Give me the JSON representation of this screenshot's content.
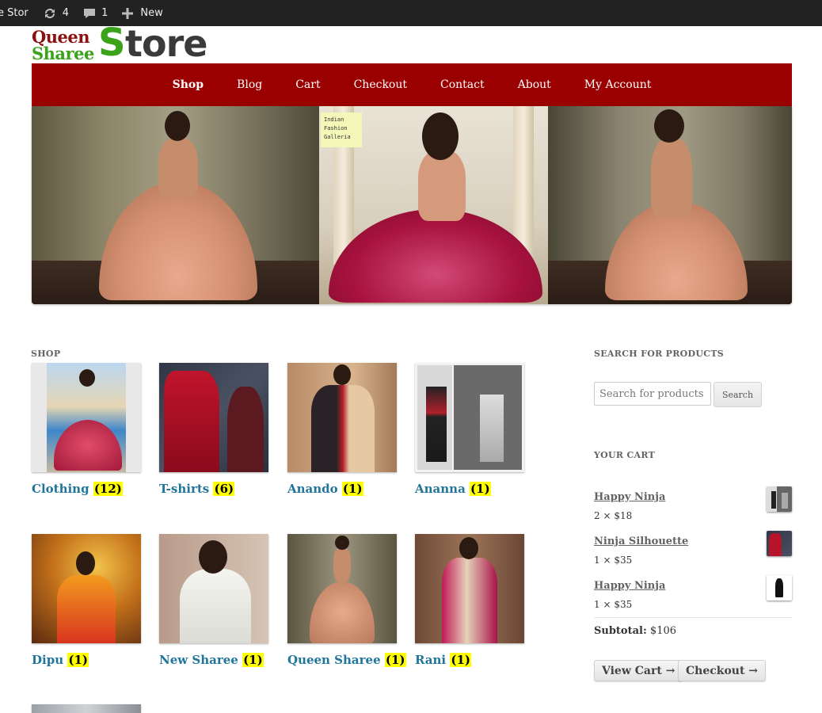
{
  "adminbar": {
    "site_name": "e Stor",
    "updates_count": "4",
    "comments_count": "1",
    "new_label": "New"
  },
  "logo": {
    "line1": "Queen",
    "line2": "Sharee",
    "store_s": "S",
    "store_rest": "tore"
  },
  "nav": {
    "items": [
      "Shop",
      "Blog",
      "Cart",
      "Checkout",
      "Contact",
      "About",
      "My Account"
    ]
  },
  "banner": {
    "badge_text": "Indian Fashion Galleria"
  },
  "shop": {
    "title": "SHOP",
    "categories": [
      {
        "name": "Clothing",
        "count": "(12)"
      },
      {
        "name": "T-shirts",
        "count": "(6)"
      },
      {
        "name": "Anando",
        "count": "(1)"
      },
      {
        "name": "Ananna",
        "count": "(1)"
      },
      {
        "name": "Dipu",
        "count": "(1)"
      },
      {
        "name": "New Sharee",
        "count": "(1)"
      },
      {
        "name": "Queen Sharee",
        "count": "(1)"
      },
      {
        "name": "Rani",
        "count": "(1)"
      }
    ]
  },
  "sidebar": {
    "search_title": "SEARCH FOR PRODUCTS",
    "search_placeholder": "Search for products",
    "search_button": "Search",
    "cart_title": "YOUR CART",
    "cart_items": [
      {
        "title": "Happy Ninja",
        "qty": "2 × $18"
      },
      {
        "title": "Ninja Silhouette",
        "qty": "1 × $35"
      },
      {
        "title": "Happy Ninja",
        "qty": "1 × $35"
      }
    ],
    "subtotal_label": "Subtotal:",
    "subtotal_value": "$106",
    "view_cart_button": "View Cart →",
    "checkout_button": "Checkout →"
  },
  "colors": {
    "nav_bg": "#9b0000",
    "link": "#21759b",
    "count_highlight": "#ffff00",
    "logo_red": "#8b1010",
    "logo_green": "#3aa31a"
  }
}
